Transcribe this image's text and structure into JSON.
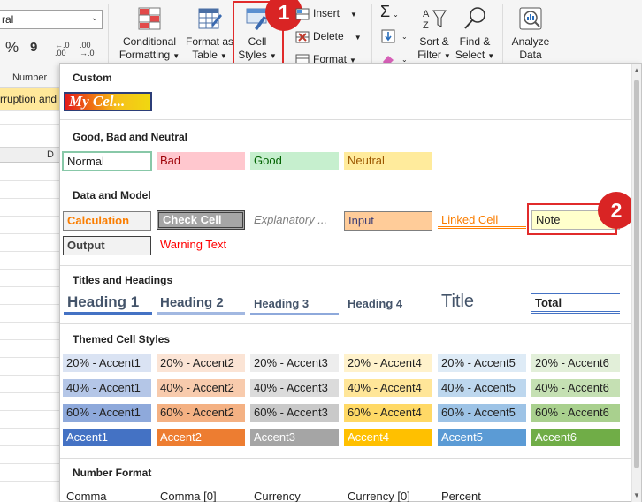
{
  "ribbon": {
    "number_format_value": "ral",
    "number_group_label": "Number",
    "percent_symbol": "%",
    "comma_symbol": "9",
    "increase_decimal": "←.0 .00",
    "decrease_decimal": ".00 →.0",
    "conditional_formatting": {
      "line1": "Conditional",
      "line2": "Formatting"
    },
    "format_as_table": {
      "line1": "Format as",
      "line2": "Table"
    },
    "cell_styles": {
      "line1": "Cell",
      "line2": "Styles"
    },
    "insert_label": "Insert",
    "delete_label": "Delete",
    "format_label": "Format",
    "sort_filter": {
      "line1": "Sort &",
      "line2": "Filter"
    },
    "find_select": {
      "line1": "Find &",
      "line2": "Select"
    },
    "analyze_data": {
      "line1": "Analyze",
      "line2": "Data"
    }
  },
  "badges": {
    "step1": "1",
    "step2": "2"
  },
  "sheet": {
    "cell_text": "rruption and",
    "column_letter": "D"
  },
  "panel": {
    "custom": {
      "header": "Custom",
      "my_cell": "My Cel..."
    },
    "good_bad": {
      "header": "Good, Bad and Neutral",
      "normal": "Normal",
      "bad": "Bad",
      "good": "Good",
      "neutral": "Neutral"
    },
    "data_model": {
      "header": "Data and Model",
      "calculation": "Calculation",
      "check_cell": "Check Cell",
      "explanatory": "Explanatory ...",
      "input": "Input",
      "linked_cell": "Linked Cell",
      "note": "Note",
      "output": "Output",
      "warning": "Warning Text"
    },
    "titles": {
      "header": "Titles and Headings",
      "h1": "Heading 1",
      "h2": "Heading 2",
      "h3": "Heading 3",
      "h4": "Heading 4",
      "title": "Title",
      "total": "Total"
    },
    "themed": {
      "header": "Themed Cell Styles",
      "row20": [
        "20% - Accent1",
        "20% - Accent2",
        "20% - Accent3",
        "20% - Accent4",
        "20% - Accent5",
        "20% - Accent6"
      ],
      "row40": [
        "40% - Accent1",
        "40% - Accent2",
        "40% - Accent3",
        "40% - Accent4",
        "40% - Accent5",
        "40% - Accent6"
      ],
      "row60": [
        "60% - Accent1",
        "60% - Accent2",
        "60% - Accent3",
        "60% - Accent4",
        "60% - Accent5",
        "60% - Accent6"
      ],
      "row100": [
        "Accent1",
        "Accent2",
        "Accent3",
        "Accent4",
        "Accent5",
        "Accent6"
      ]
    },
    "number_format": {
      "header": "Number Format",
      "items": [
        "Comma",
        "Comma [0]",
        "Currency",
        "Currency [0]",
        "Percent"
      ]
    }
  },
  "colors": {
    "highlight_red": "#e12b2b",
    "accent1": "#4472c4",
    "accent2": "#ed7d31",
    "accent3": "#a5a5a5",
    "accent4": "#ffc000",
    "accent5": "#5b9bd5",
    "accent6": "#70ad47"
  }
}
